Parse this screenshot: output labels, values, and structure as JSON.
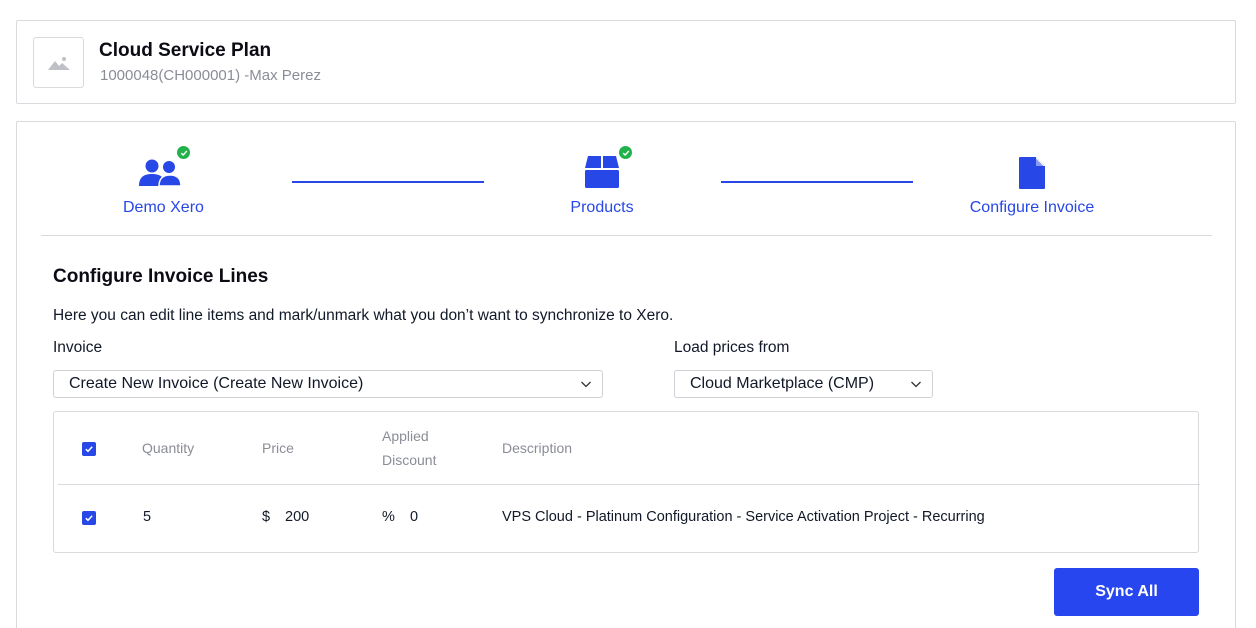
{
  "header": {
    "title": "Cloud Service Plan",
    "subtitle": "1000048(CH000001) -Max Perez",
    "thumbnail_icon": "image-placeholder-icon"
  },
  "steps": [
    {
      "label": "Demo Xero",
      "icon": "users-icon",
      "completed": true
    },
    {
      "label": "Products",
      "icon": "box-icon",
      "completed": true
    },
    {
      "label": "Configure Invoice",
      "icon": "document-icon",
      "completed": false
    }
  ],
  "section": {
    "title": "Configure Invoice Lines",
    "description": "Here you can edit line items and mark/unmark what you don’t want to synchronize to Xero."
  },
  "invoice_field": {
    "label": "Invoice",
    "value": "Create New Invoice (Create New Invoice)"
  },
  "prices_field": {
    "label": "Load prices from",
    "value": "Cloud Marketplace (CMP)"
  },
  "table": {
    "header_checked": true,
    "columns": {
      "quantity": "Quantity",
      "price": "Price",
      "discount_line1": "Applied",
      "discount_line2": "Discount",
      "description": "Description"
    },
    "rows": [
      {
        "checked": true,
        "quantity": "5",
        "currency": "$",
        "price": "200",
        "discount_symbol": "%",
        "discount": "0",
        "description": "VPS Cloud - Platinum Configuration - Service Activation Project - Recurring"
      }
    ]
  },
  "actions": {
    "sync_all": "Sync All"
  },
  "colors": {
    "accent": "#2747e6",
    "success": "#22b24c",
    "border": "#d9d9de",
    "muted_text": "#8a8d96"
  }
}
